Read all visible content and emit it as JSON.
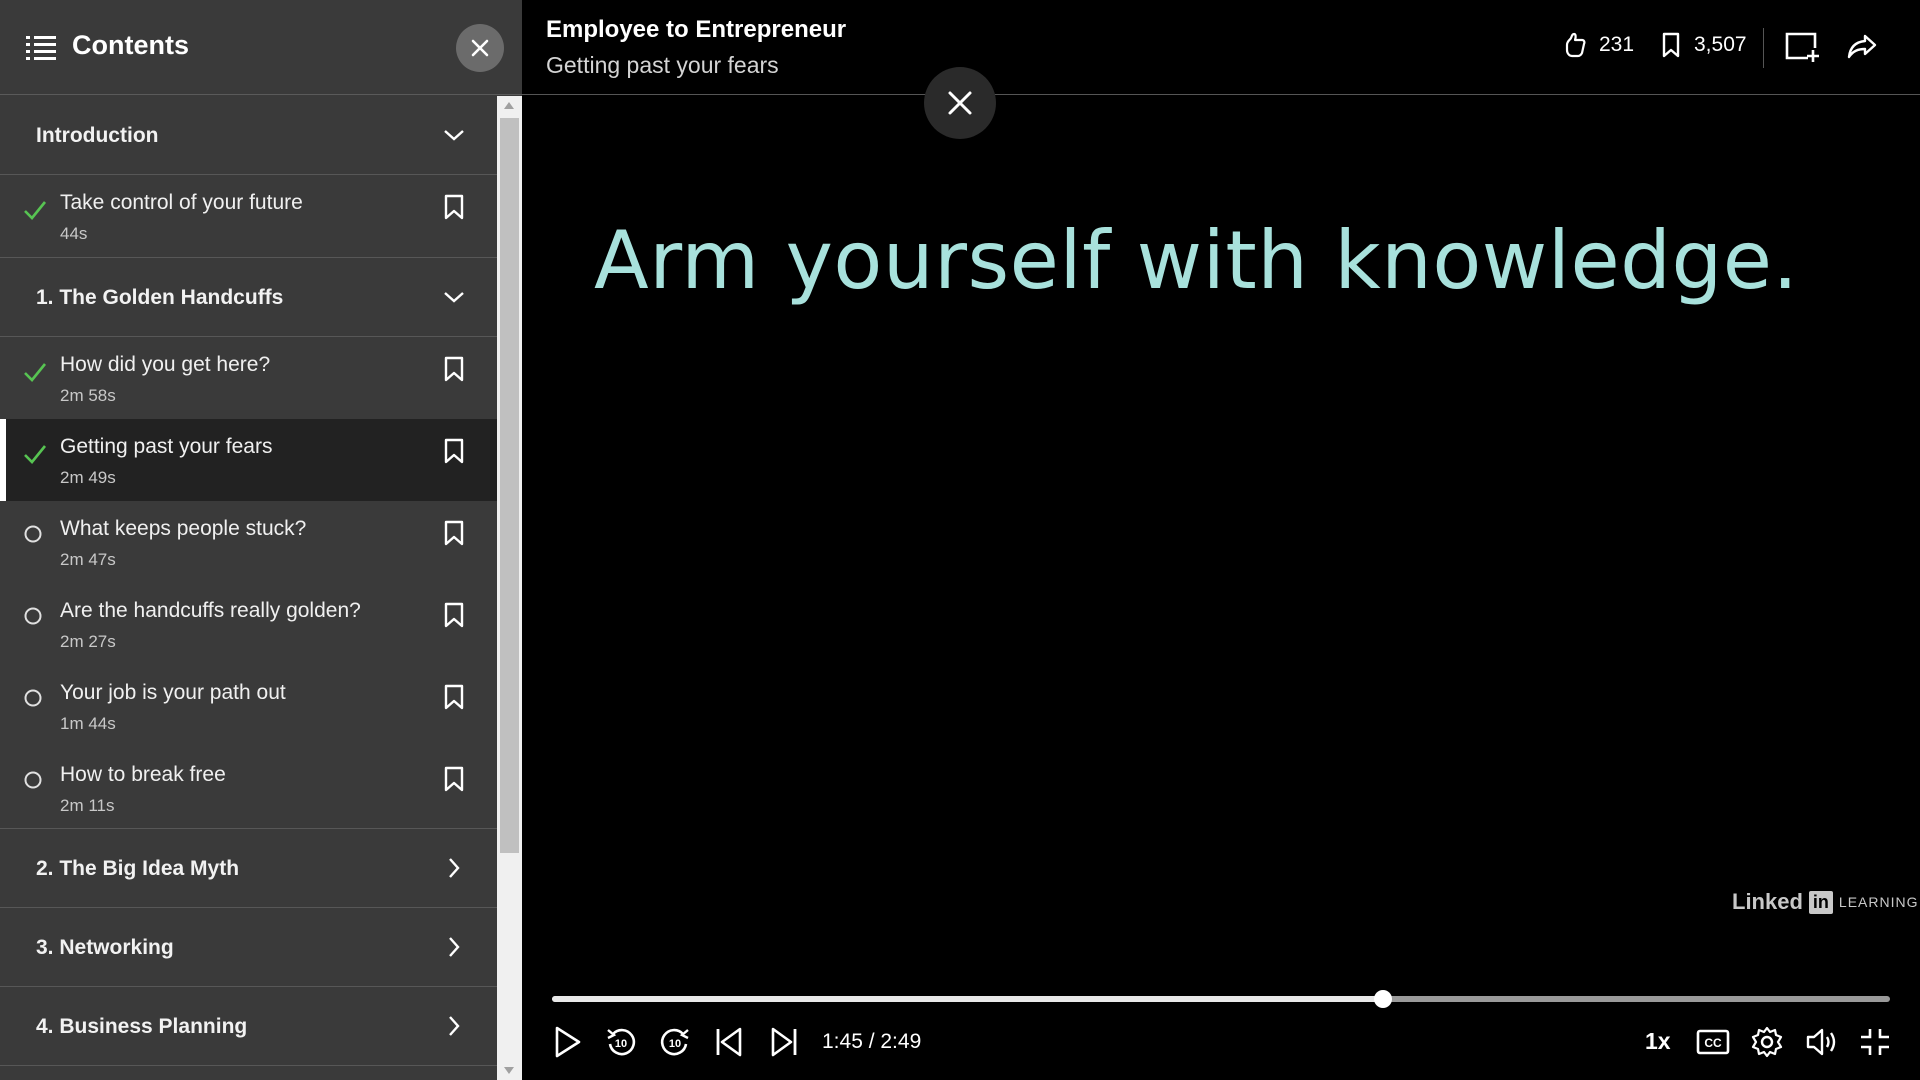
{
  "sidebar": {
    "title": "Contents",
    "sections": [
      {
        "label": "Introduction",
        "expanded": true,
        "items": [
          {
            "name": "Take control of your future",
            "duration": "44s",
            "status": "completed"
          }
        ]
      },
      {
        "label": "1. The Golden Handcuffs",
        "expanded": true,
        "items": [
          {
            "name": "How did you get here?",
            "duration": "2m 58s",
            "status": "completed"
          },
          {
            "name": "Getting past your fears",
            "duration": "2m 49s",
            "status": "completed",
            "active": true
          },
          {
            "name": "What keeps people stuck?",
            "duration": "2m 47s",
            "status": "not-started"
          },
          {
            "name": "Are the handcuffs really golden?",
            "duration": "2m 27s",
            "status": "not-started"
          },
          {
            "name": "Your job is your path out",
            "duration": "1m 44s",
            "status": "not-started"
          },
          {
            "name": "How to break free",
            "duration": "2m 11s",
            "status": "not-started"
          }
        ]
      },
      {
        "label": "2. The Big Idea Myth",
        "expanded": false
      },
      {
        "label": "3. Networking",
        "expanded": false
      },
      {
        "label": "4. Business Planning",
        "expanded": false
      }
    ]
  },
  "header": {
    "course_title": "Employee to Entrepreneur",
    "video_title": "Getting past your fears",
    "likes": "231",
    "saves": "3,507"
  },
  "video": {
    "slide_text": "Arm yourself with knowledge.",
    "watermark": {
      "linked": "Linked",
      "in": "in",
      "learning": "LEARNING"
    }
  },
  "player": {
    "current_time": "1:45",
    "total_time": "2:49",
    "time_display": "1:45 / 2:49",
    "progress": 0.621,
    "speed": "1x"
  },
  "colors": {
    "sidebar_bg": "#3a3a3a",
    "check_green": "#57c452",
    "slide_text": "#a8e1dc"
  },
  "icons": [
    "list-icon",
    "close-icon",
    "chevron-down-icon",
    "chevron-right-icon",
    "check-icon",
    "circle-icon",
    "bookmark-icon",
    "like-icon",
    "add-to-collection-icon",
    "share-icon",
    "play-icon",
    "rewind-10-icon",
    "forward-10-icon",
    "previous-icon",
    "next-icon",
    "captions-icon",
    "settings-icon",
    "volume-icon",
    "exit-fullscreen-icon"
  ]
}
